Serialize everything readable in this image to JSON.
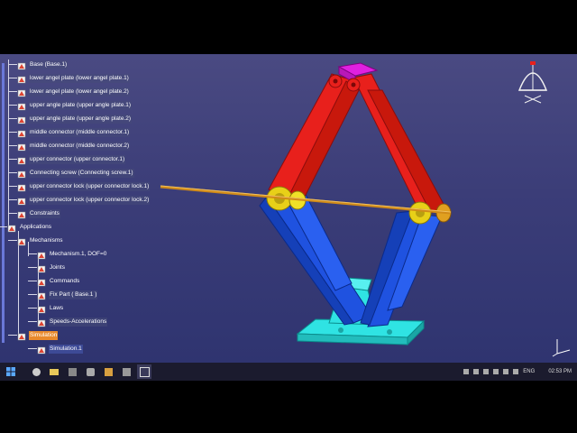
{
  "tree": {
    "items": [
      {
        "label": "Base (Base.1)"
      },
      {
        "label": "lower angel plate (lower angel plate.1)"
      },
      {
        "label": "lower angel plate (lower angel plate.2)"
      },
      {
        "label": "upper angle plate (upper angle plate.1)"
      },
      {
        "label": "upper angle plate (upper angle plate.2)"
      },
      {
        "label": "middle connector (middle connector.1)"
      },
      {
        "label": "middle connector (middle connector.2)"
      },
      {
        "label": "upper connector (upper connector.1)"
      },
      {
        "label": "Connecting screw (Connecting screw.1)"
      },
      {
        "label": "upper connector lock (upper connector lock.1)"
      },
      {
        "label": "upper connector lock (upper connector lock.2)"
      }
    ],
    "constraints": "Constraints",
    "applications": "Applications",
    "mechanisms": "Mechanisms",
    "mechanism1": "Mechanism.1, DOF=0",
    "joints": "Joints",
    "commands": "Commands",
    "fix_part": "Fix Part ( Base.1 )",
    "laws": "Laws",
    "speeds": "Speeds-Accelerations",
    "simulation": "Simulation",
    "simulation1": "Simulation.1"
  },
  "taskbar": {
    "language": "ENG",
    "time": "02:53 PM"
  },
  "colors": {
    "upper_arms": "#e8201c",
    "lower_arms": "#1f52e0",
    "base": "#2fe3e3",
    "top_plate": "#e020e0",
    "screw": "#d08a18"
  }
}
